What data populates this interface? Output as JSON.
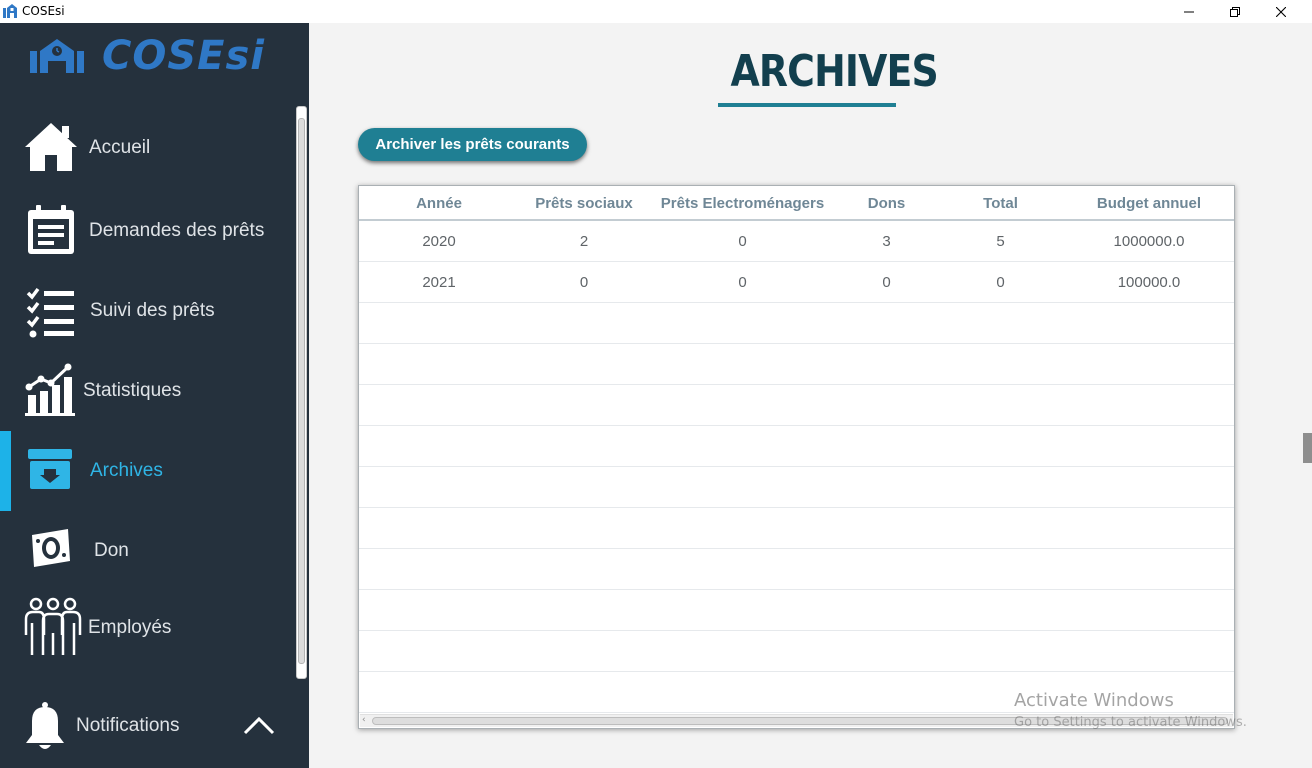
{
  "window": {
    "title": "COSEsi",
    "controls": [
      "minimize-icon",
      "maximize-icon",
      "close-icon"
    ]
  },
  "sidebar": {
    "logo_text": "COSEsi",
    "items": [
      {
        "label": "Accueil",
        "icon": "home-icon"
      },
      {
        "label": "Demandes des prêts",
        "icon": "calendar-form-icon"
      },
      {
        "label": "Suivi des prêts",
        "icon": "checklist-icon"
      },
      {
        "label": "Statistiques",
        "icon": "bar-chart-icon"
      },
      {
        "label": "Archives",
        "icon": "archive-box-icon",
        "active": true
      },
      {
        "label": "Don",
        "icon": "money-icon"
      },
      {
        "label": "Employés",
        "icon": "people-icon"
      }
    ],
    "notifications": {
      "label": "Notifications",
      "icon": "bell-icon",
      "toggle_icon": "chevron-up-icon"
    },
    "active_color": "#1db2e8",
    "background": "#25313d"
  },
  "main": {
    "title": "ARCHIVES",
    "archive_button_label": "Archiver les prêts courants",
    "accent": "#1f7f93",
    "table": {
      "columns": [
        "Année",
        "Prêts sociaux",
        "Prêts Electroménagers",
        "Dons",
        "Total",
        "Budget annuel"
      ],
      "rows": [
        [
          "2020",
          "2",
          "0",
          "3",
          "5",
          "1000000.0"
        ],
        [
          "2021",
          "0",
          "0",
          "0",
          "0",
          "100000.0"
        ]
      ],
      "empty_rows": 10
    }
  },
  "watermark": {
    "line1": "Activate Windows",
    "line2": "Go to Settings to activate Windows."
  }
}
